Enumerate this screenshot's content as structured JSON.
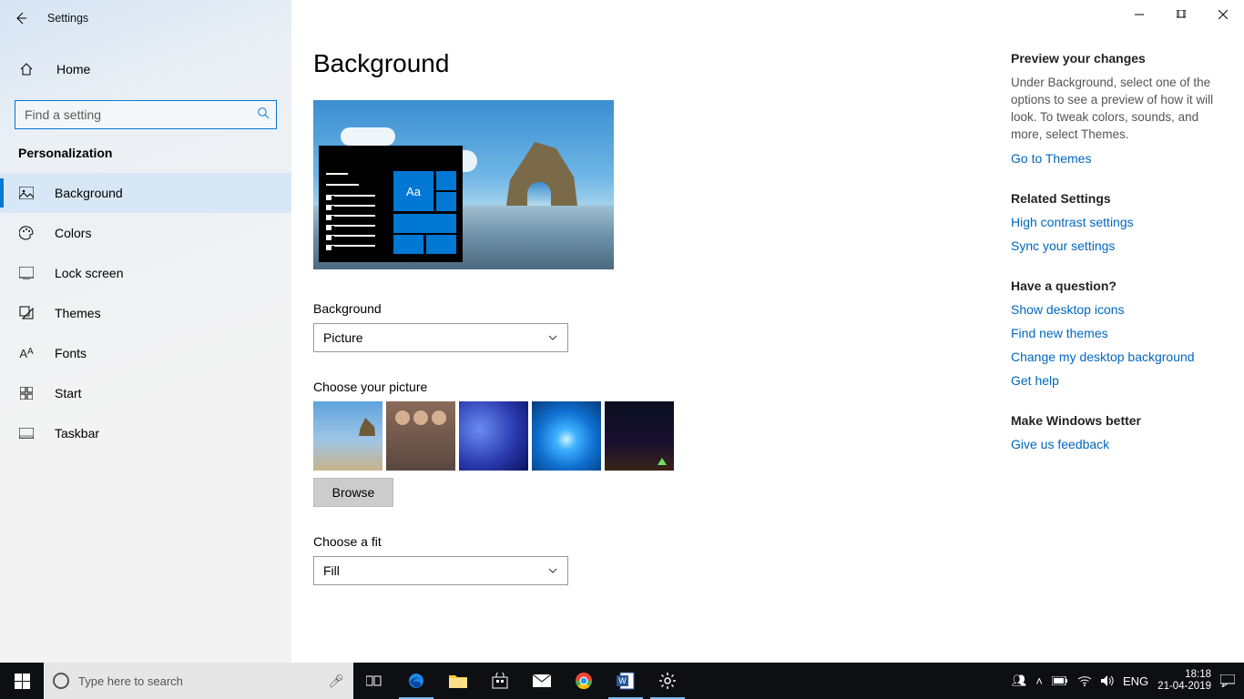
{
  "titlebar": {
    "title": "Settings"
  },
  "sidebar": {
    "home": "Home",
    "search_placeholder": "Find a setting",
    "category": "Personalization",
    "items": [
      {
        "label": "Background",
        "icon": "picture-icon",
        "active": true
      },
      {
        "label": "Colors",
        "icon": "palette-icon"
      },
      {
        "label": "Lock screen",
        "icon": "lock-screen-icon"
      },
      {
        "label": "Themes",
        "icon": "themes-icon"
      },
      {
        "label": "Fonts",
        "icon": "fonts-icon"
      },
      {
        "label": "Start",
        "icon": "start-icon"
      },
      {
        "label": "Taskbar",
        "icon": "taskbar-icon"
      }
    ]
  },
  "main": {
    "title": "Background",
    "preview_sample": "Aa",
    "background_label": "Background",
    "background_value": "Picture",
    "choose_picture_label": "Choose your picture",
    "browse_label": "Browse",
    "choose_fit_label": "Choose a fit",
    "choose_fit_value": "Fill"
  },
  "right": {
    "preview_head": "Preview your changes",
    "preview_body": "Under Background, select one of the options to see a preview of how it will look. To tweak colors, sounds, and more, select Themes.",
    "themes_link": "Go to Themes",
    "related_head": "Related Settings",
    "related_links": [
      "High contrast settings",
      "Sync your settings"
    ],
    "question_head": "Have a question?",
    "question_links": [
      "Show desktop icons",
      "Find new themes",
      "Change my desktop background",
      "Get help"
    ],
    "better_head": "Make Windows better",
    "feedback_link": "Give us feedback"
  },
  "taskbar": {
    "search_placeholder": "Type here to search",
    "lang": "ENG",
    "time": "18:18",
    "date": "21-04-2019"
  }
}
